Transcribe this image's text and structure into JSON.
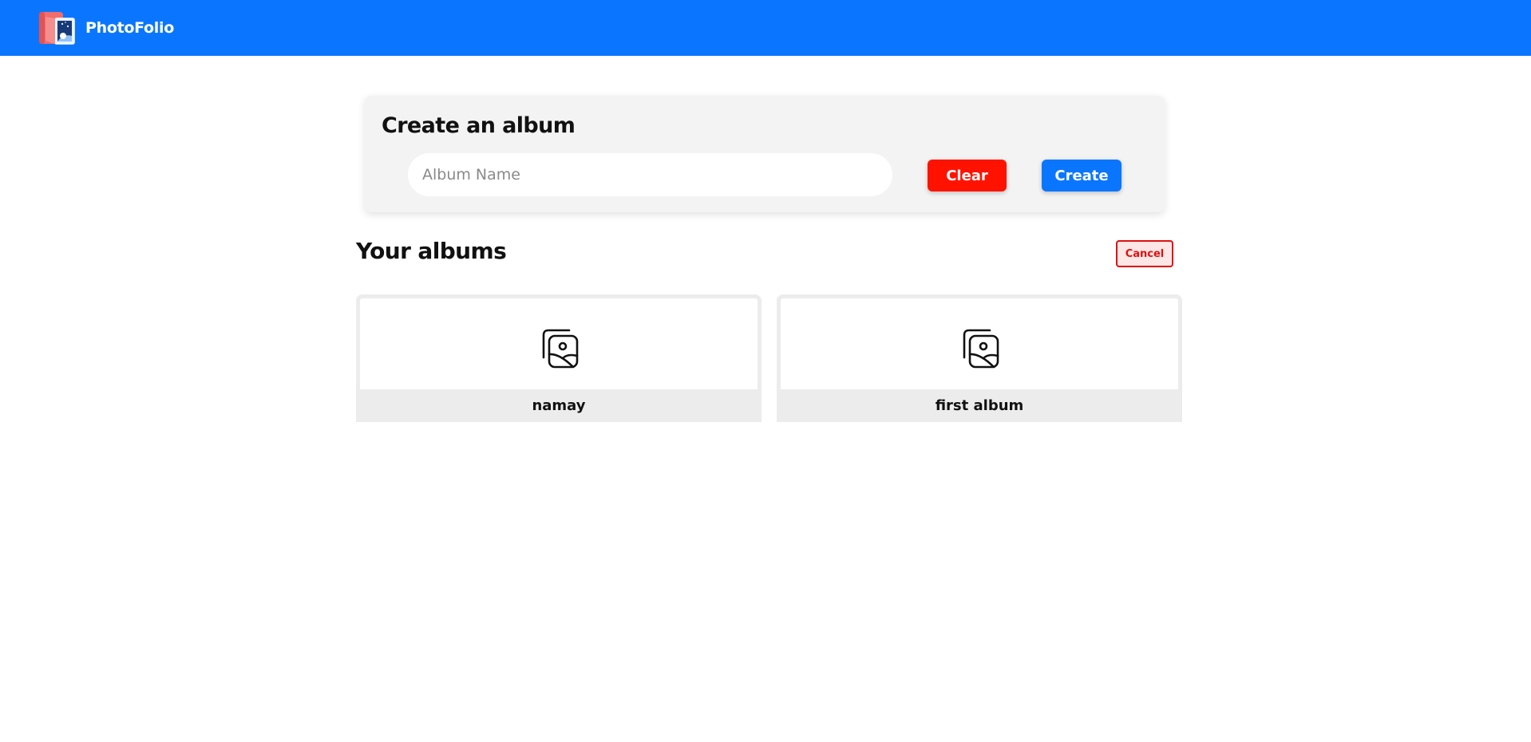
{
  "navbar": {
    "brand_name": "PhotoFolio",
    "logo_icon": "photo-album-icon",
    "background_color": "#0a76ff"
  },
  "create_form": {
    "title": "Create an album",
    "input_placeholder": "Album Name",
    "input_value": "",
    "clear_label": "Clear",
    "create_label": "Create",
    "clear_color": "#ff1300",
    "create_color": "#0a76ff"
  },
  "albums_section": {
    "title": "Your albums",
    "cancel_label": "Cancel",
    "cancel_color": "#e01010"
  },
  "albums": [
    {
      "name": "namay",
      "icon": "image-gallery-icon"
    },
    {
      "name": "first album",
      "icon": "image-gallery-icon"
    }
  ]
}
